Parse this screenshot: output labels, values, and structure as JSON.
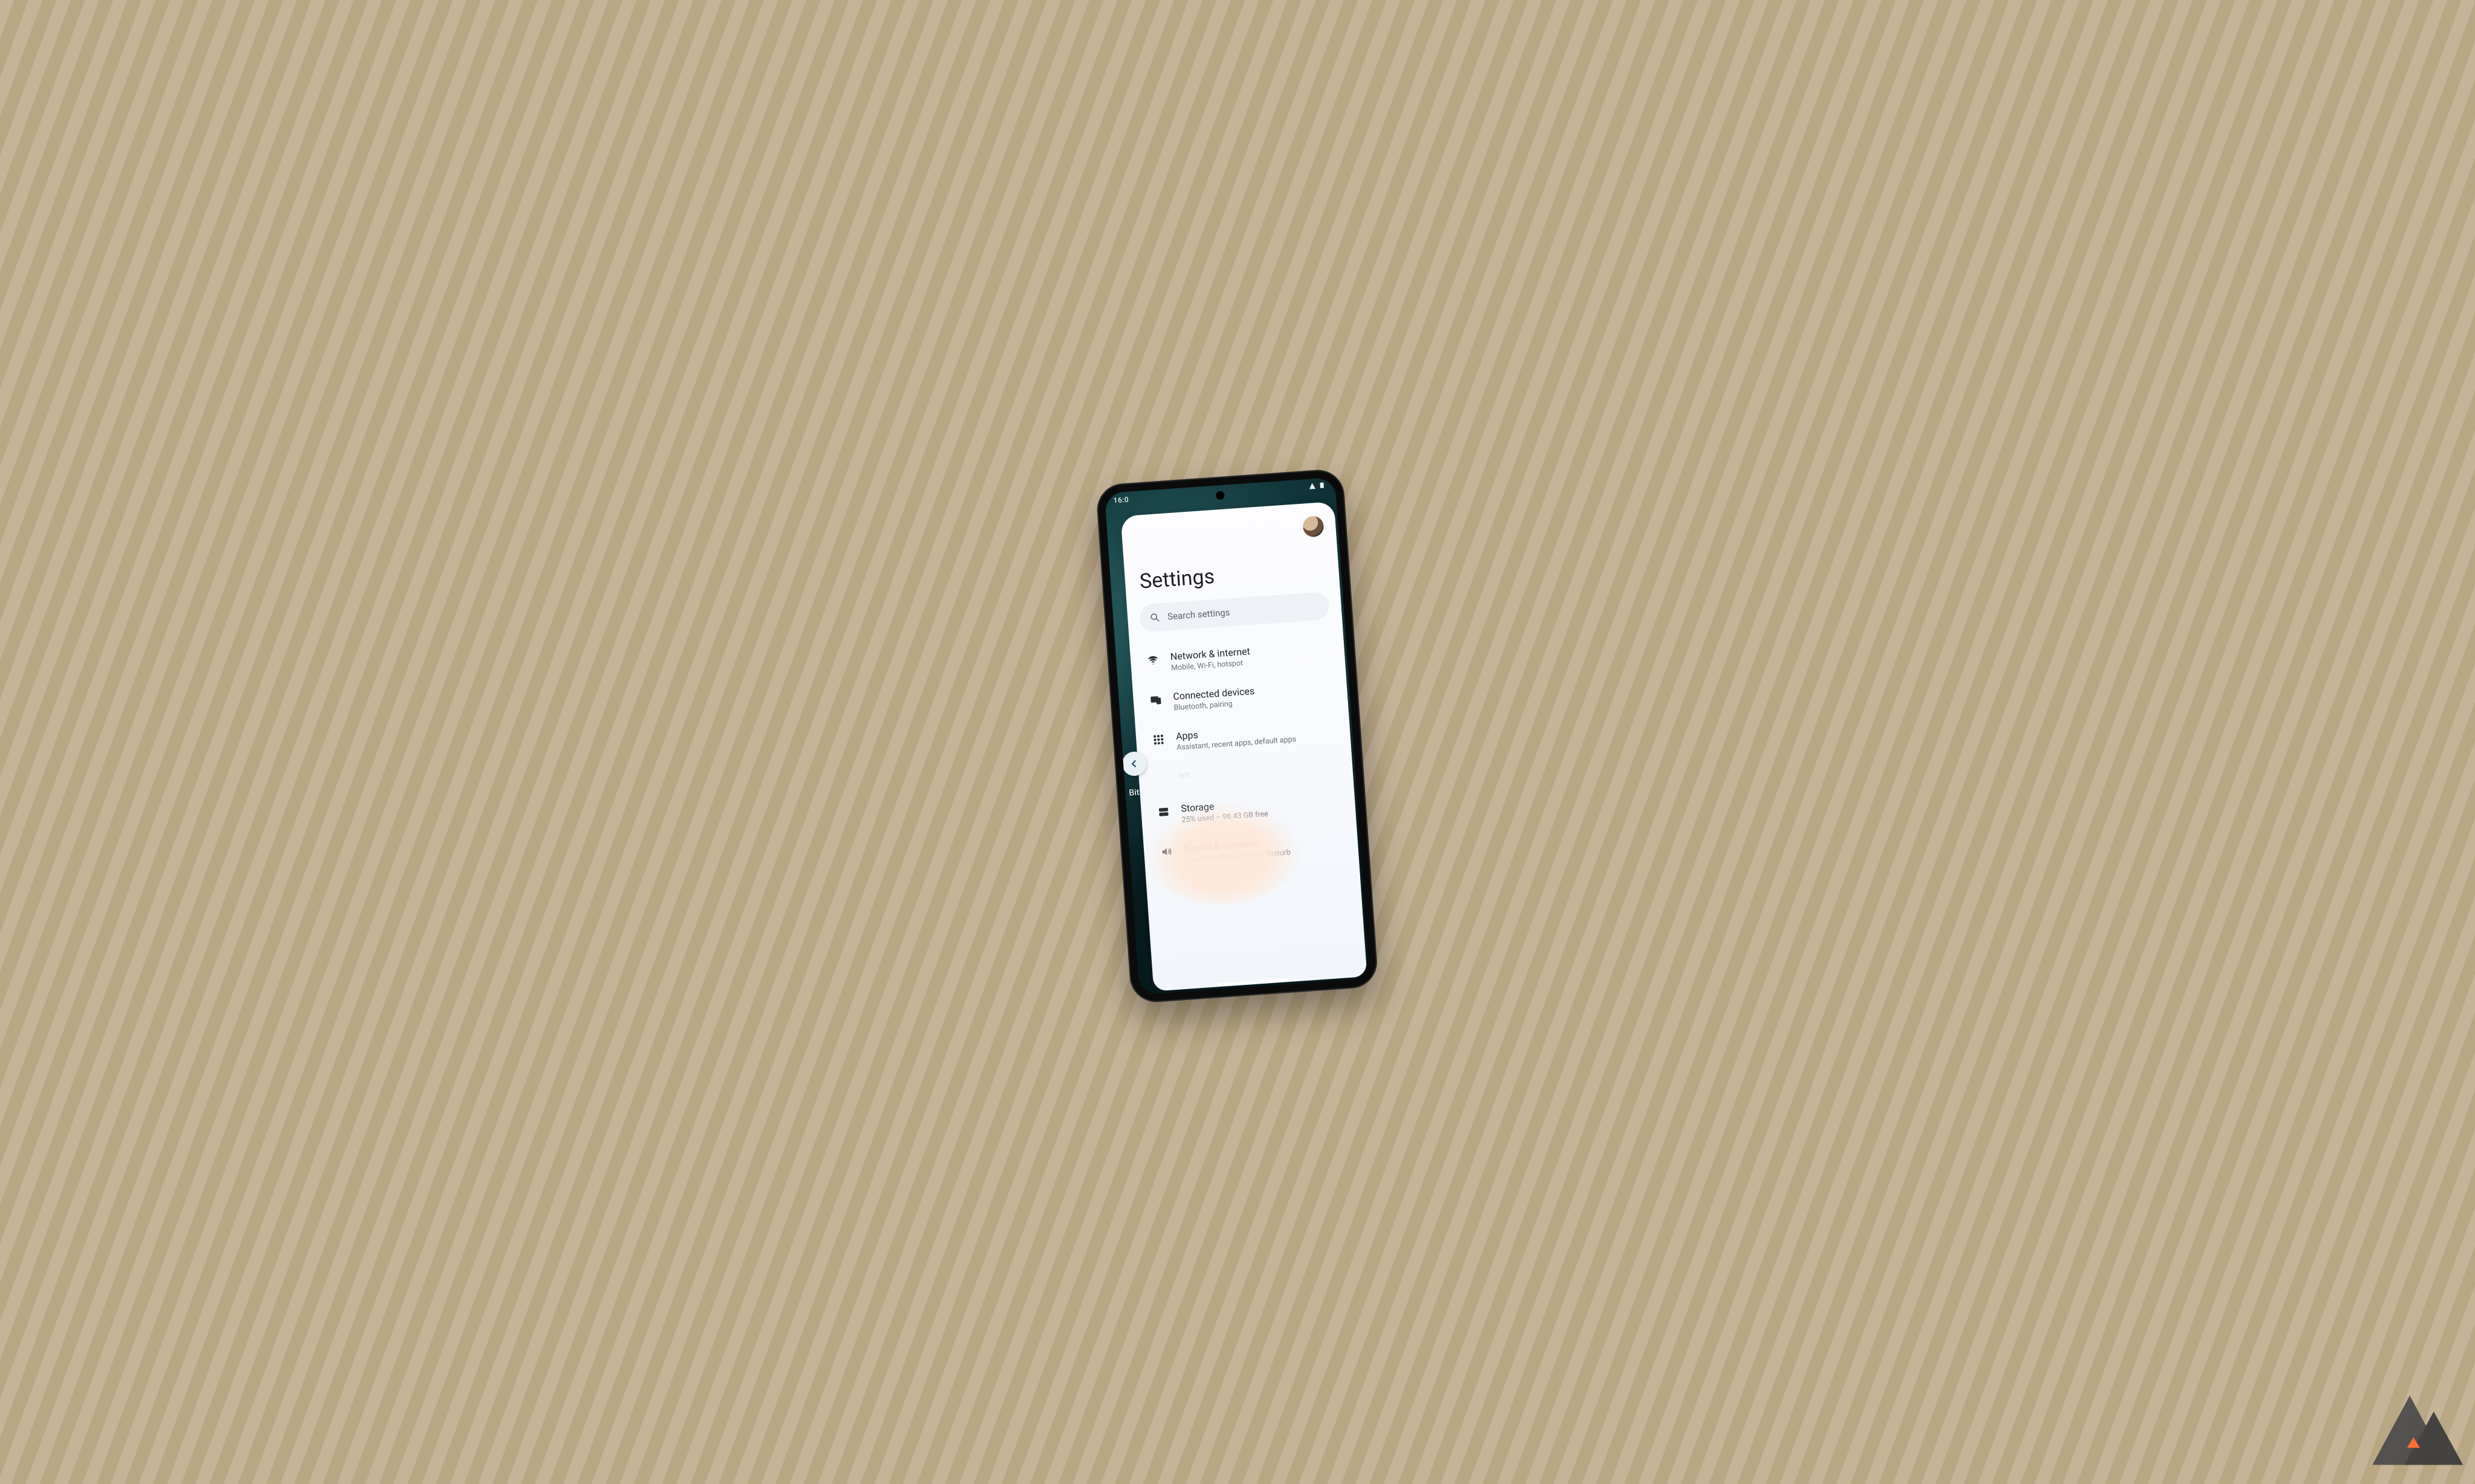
{
  "statusbar": {
    "time": "16:0"
  },
  "back_hint": "Bit",
  "sheet": {
    "title": "Settings",
    "search_placeholder": "Search settings",
    "items": [
      {
        "icon": "wifi",
        "label": "Network & internet",
        "sub": "Mobile, Wi-Fi, hotspot"
      },
      {
        "icon": "devices",
        "label": "Connected devices",
        "sub": "Bluetooth, pairing"
      },
      {
        "icon": "apps",
        "label": "Apps",
        "sub": "Assistant, recent apps, default apps"
      },
      {
        "icon": "blank",
        "label": "",
        "sub": "left"
      },
      {
        "icon": "storage",
        "label": "Storage",
        "sub": "25% used – 96.43 GB free"
      },
      {
        "icon": "sound",
        "label": "Sound & vibration",
        "sub": "Volume, haptics, Do Not Disturb"
      }
    ]
  }
}
